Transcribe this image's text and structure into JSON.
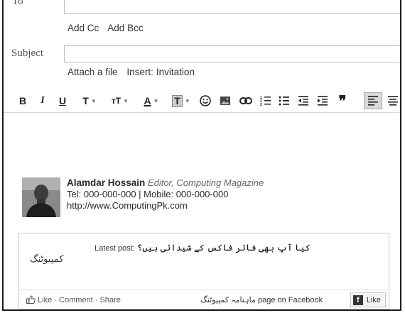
{
  "to": {
    "label": "To",
    "value": ""
  },
  "cc_links": {
    "add_cc": "Add Cc",
    "add_bcc": "Add Bcc"
  },
  "subject": {
    "label": "Subject",
    "value": ""
  },
  "attach": {
    "attach_file": "Attach a file",
    "insert_label": "Insert:",
    "invitation": "Invitation"
  },
  "toolbar": {
    "bold": "B",
    "italic": "I",
    "underline": "U",
    "font": "T",
    "size": "тT",
    "text_color": "A",
    "highlight": "T",
    "quote": "❞"
  },
  "signature": {
    "name": "Alamdar Hossain",
    "title": "Editor, Computing Magazine",
    "phone": "Tel: 000-000-000 | Mobile: 000-000-000",
    "website": "http://www.ComputingPk.com"
  },
  "facebook": {
    "logo_text": "کمپیوٹنگ",
    "latest_post_label": "Latest post:",
    "latest_post_text": "کیا آپ بھی فائر فاکس کے شیدائی ہیں؟",
    "like_link": "Like",
    "comment_link": "Comment",
    "share_link": "Share",
    "page_name": "ماہنامہ کمپیوٹنگ",
    "page_suffix": "page on Facebook",
    "like_button": "Like"
  }
}
